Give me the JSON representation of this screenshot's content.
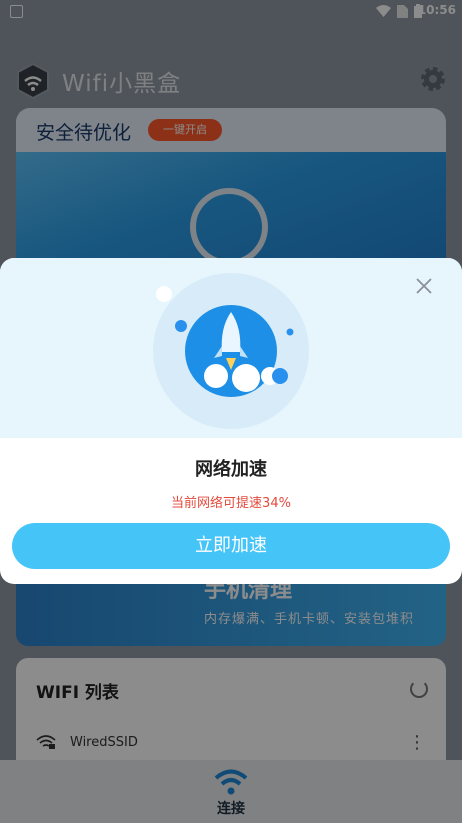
{
  "status_bar": {
    "time": "10:56"
  },
  "header": {
    "app_title": "Wifi小黑盒"
  },
  "main_card": {
    "title": "安全待优化",
    "action_label": "一键开启"
  },
  "clean_card": {
    "title": "手机清理",
    "subtitle": "内存爆满、手机卡顿、安装包堆积"
  },
  "wifi_list": {
    "title": "WIFI 列表",
    "items": [
      {
        "ssid": "WiredSSID"
      }
    ]
  },
  "bottom_nav": {
    "label": "连接"
  },
  "modal": {
    "title": "网络加速",
    "subtitle": "当前网络可提速34%",
    "button_label": "立即加速"
  },
  "colors": {
    "accent": "#45c4f8",
    "warning": "#e44a3c",
    "badge": "#ff5a2a"
  }
}
